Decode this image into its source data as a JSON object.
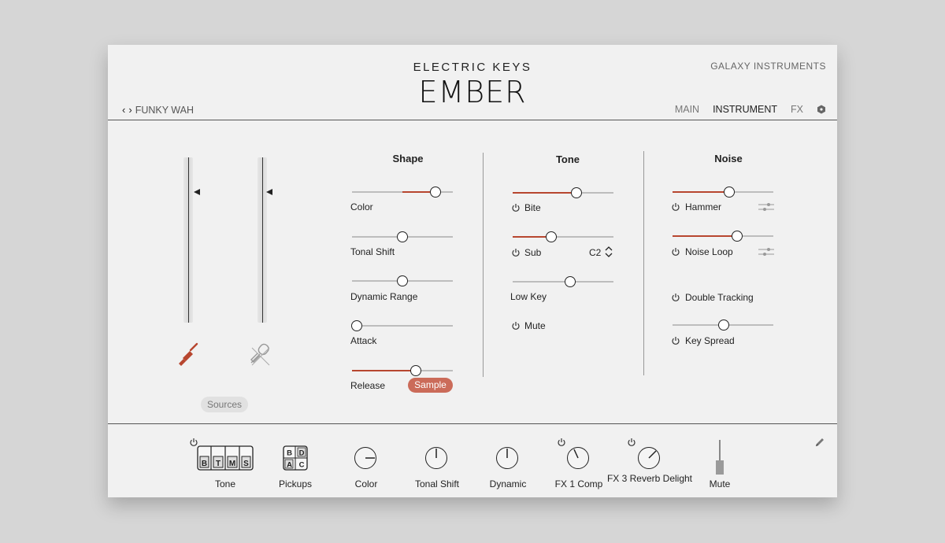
{
  "header": {
    "brand_sub": "ELECTRIC KEYS",
    "brand_main": "EMBER",
    "maker": "GALAXY INSTRUMENTS",
    "preset": "FUNKY WAH",
    "tabs": [
      {
        "label": "MAIN",
        "active": false
      },
      {
        "label": "INSTRUMENT",
        "active": true
      },
      {
        "label": "FX",
        "active": false
      }
    ]
  },
  "sources": {
    "button_label": "Sources",
    "meter_levels": [
      0.75,
      0.75
    ],
    "icons": [
      "jack-plug-icon",
      "microphone-muted-icon"
    ]
  },
  "shape": {
    "title": "Shape",
    "controls": [
      {
        "label": "Color",
        "value": 0.83,
        "fill_from": 0.5
      },
      {
        "label": "Tonal Shift",
        "value": 0.5,
        "fill_from": null
      },
      {
        "label": "Dynamic Range",
        "value": 0.5,
        "fill_from": null
      },
      {
        "label": "Attack",
        "value": 0.05,
        "fill_from": null
      },
      {
        "label": "Release",
        "value": 0.63,
        "fill_from": 0.0
      }
    ],
    "sample_label": "Sample"
  },
  "tone": {
    "title": "Tone",
    "controls": [
      {
        "label": "Bite",
        "value": 0.63,
        "fill_from": 0.0,
        "power": true
      },
      {
        "label": "Sub",
        "value": 0.38,
        "fill_from": 0.0,
        "power": true
      },
      {
        "label": "Low Key",
        "value": 0.57,
        "fill_from": null,
        "power": false
      }
    ],
    "sub_note": "C2",
    "mute_label": "Mute"
  },
  "noise": {
    "title": "Noise",
    "controls": [
      {
        "label": "Hammer",
        "value": 0.56,
        "fill_from": 0.0
      },
      {
        "label": "Noise Loop",
        "value": 0.64,
        "fill_from": 0.0
      }
    ],
    "double_tracking_label": "Double Tracking",
    "key_spread": {
      "label": "Key Spread",
      "value": 0.51
    }
  },
  "macros": {
    "tone": {
      "label": "Tone",
      "keys": [
        "B",
        "T",
        "M",
        "S"
      ]
    },
    "pickups": {
      "label": "Pickups",
      "grid": [
        "B",
        "D",
        "A",
        "C"
      ]
    },
    "color": {
      "label": "Color"
    },
    "tonal_shift": {
      "label": "Tonal Shift"
    },
    "dynamic": {
      "label": "Dynamic"
    },
    "fx1": {
      "label": "FX 1 Comp"
    },
    "fx3": {
      "label": "FX 3 Reverb Delight"
    },
    "mute": {
      "label": "Mute"
    }
  },
  "colors": {
    "accent": "#b7462f",
    "sample_button": "#cb6b59"
  }
}
